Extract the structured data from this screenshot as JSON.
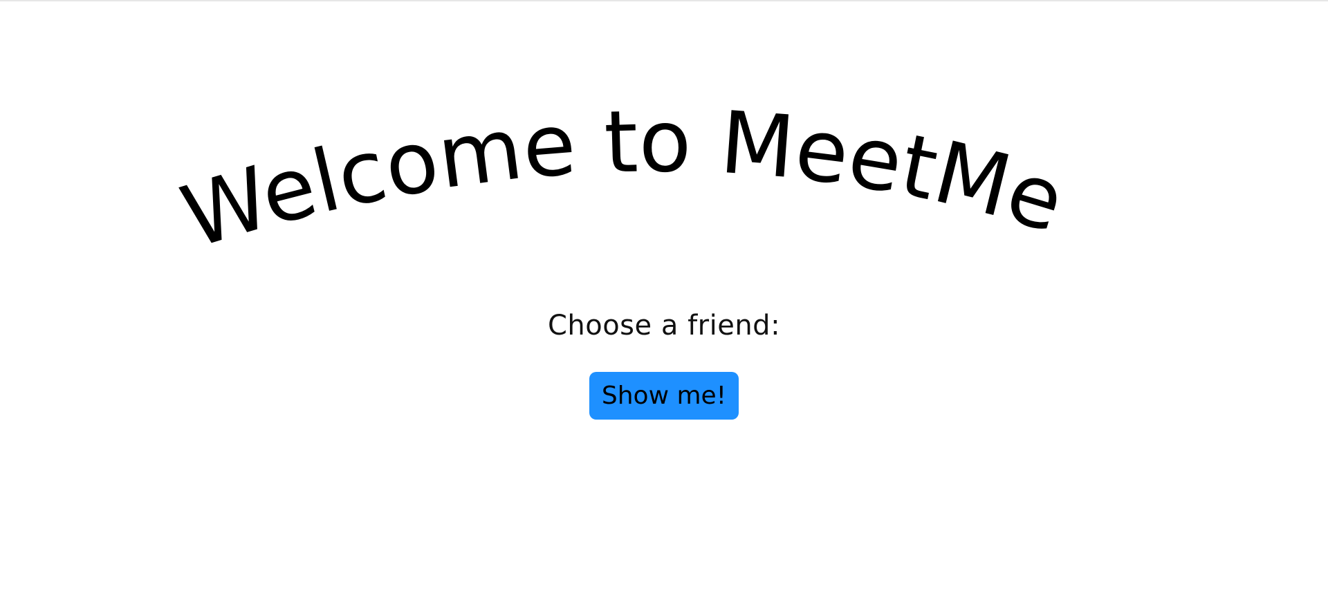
{
  "page": {
    "title": "Welcome to MeetMe",
    "prompt_label": "Choose a friend:",
    "button_label": "Show me!"
  },
  "colors": {
    "background": "#ffffff",
    "button_background": "#1e90ff",
    "text": "#000000"
  }
}
